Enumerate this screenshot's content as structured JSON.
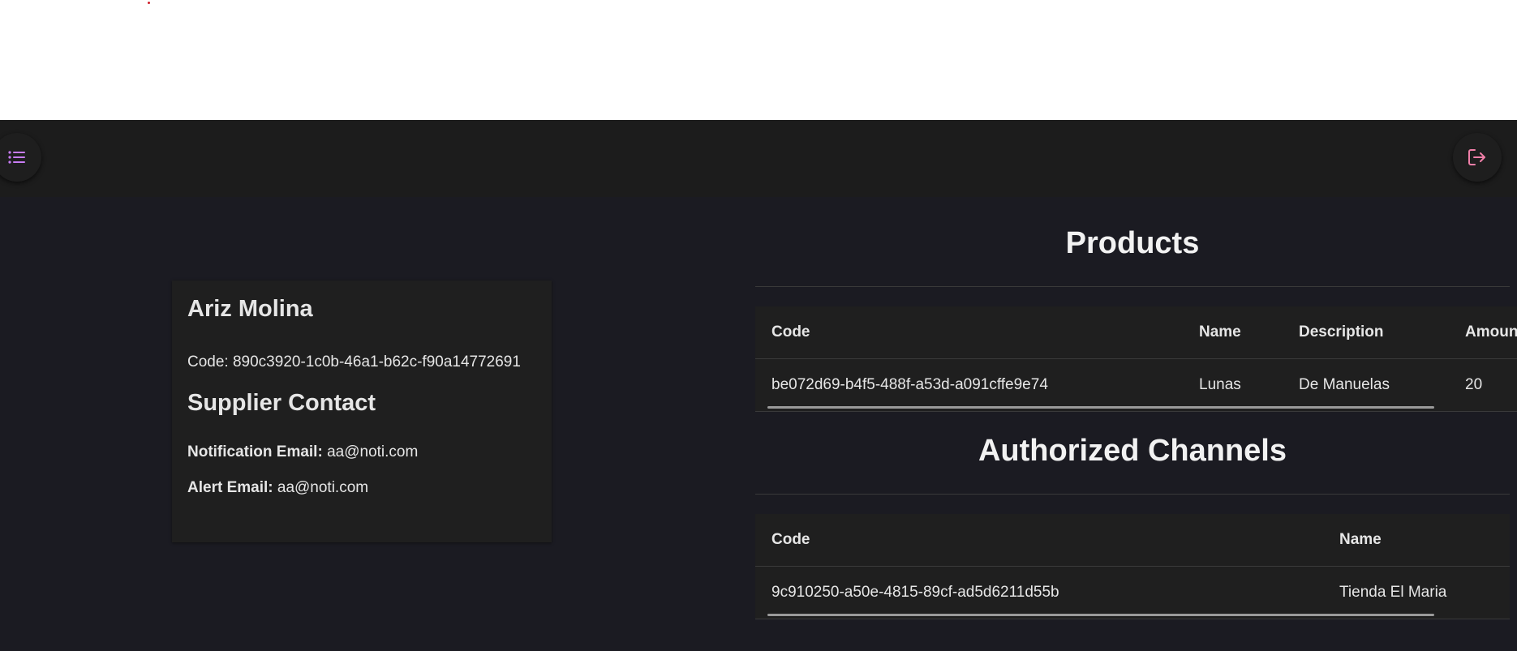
{
  "toolbar": {
    "menu_icon": "list-icon",
    "logout_icon": "logout-icon",
    "accent": "#c87cf5",
    "logout_accent": "#f07fa8"
  },
  "supplier": {
    "name": "Ariz Molina",
    "code_label": "Code:",
    "code_value": "890c3920-1c0b-46a1-b62c-f90a14772691",
    "contact_title": "Supplier Contact",
    "notification_label": "Notification Email:",
    "notification_value": "aa@noti.com",
    "alert_label": "Alert Email:",
    "alert_value": "aa@noti.com"
  },
  "products": {
    "title": "Products",
    "columns": [
      "Code",
      "Name",
      "Description",
      "Amount"
    ],
    "rows": [
      [
        "be072d69-b4f5-488f-a53d-a091cffe9e74",
        "Lunas",
        "De Manuelas",
        "20"
      ]
    ]
  },
  "channels": {
    "title": "Authorized Channels",
    "columns": [
      "Code",
      "Name"
    ],
    "rows": [
      [
        "9c910250-a50e-4815-89cf-ad5d6211d55b",
        "Tienda El Maria"
      ]
    ]
  }
}
